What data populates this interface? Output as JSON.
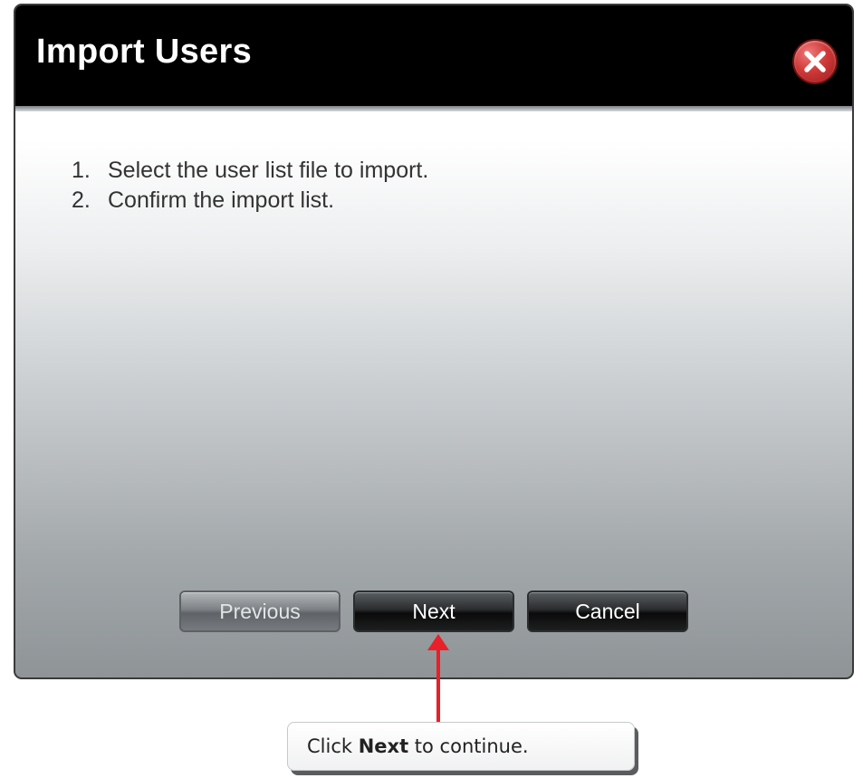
{
  "dialog": {
    "title": "Import Users",
    "close_icon": "close-x-icon",
    "steps": [
      {
        "number": "1.",
        "text": "Select the user list file to import."
      },
      {
        "number": "2.",
        "text": "Confirm the import list."
      }
    ],
    "buttons": {
      "previous": "Previous",
      "next": "Next",
      "cancel": "Cancel"
    },
    "previous_disabled": true
  },
  "annotation": {
    "prefix": "Click ",
    "bold": "Next",
    "suffix": " to continue.",
    "arrow_color": "#e8202a"
  }
}
